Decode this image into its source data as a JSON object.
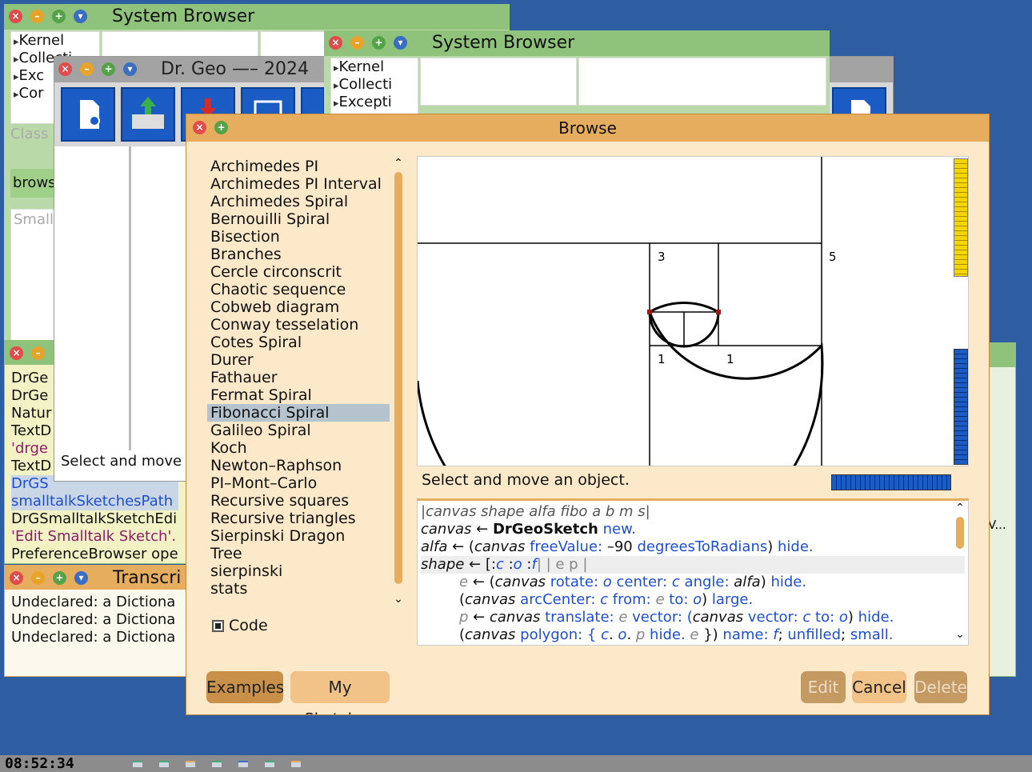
{
  "colors": {
    "desktop": "#2e5da1",
    "green_title": "#8fc27a",
    "grey_title": "#a3a3a3",
    "orange_title": "#e5ad5d",
    "orange_panel": "#fbe9ca",
    "selected": "#b5c3cf"
  },
  "sysbrowser1": {
    "title": "System Browser",
    "packages": [
      "Kernel",
      "Collecti",
      "Exc",
      "Cor"
    ],
    "class_label": "Class",
    "browse_label": "brows",
    "small_label": "Small"
  },
  "sysbrowser2": {
    "title": "System Browser",
    "packages": [
      "Kernel",
      "Collecti",
      "Excepti"
    ]
  },
  "drgeo": {
    "title": "Dr. Geo —– 2024",
    "status": "Select and move",
    "icons": [
      "new-sketch-icon",
      "open-folder-icon",
      "save-icon",
      "export-icon",
      "overflow-icon"
    ]
  },
  "workspace": {
    "lines": [
      "DrGe",
      "DrGe",
      "Natur",
      "TextD",
      "'drge",
      "TextD",
      "DrGS",
      "smalltalkSketchesPath",
      "DrGSmalltalkSketchEdi",
      "'Edit Smalltalk Sketch'.",
      "PreferenceBrowser ope"
    ]
  },
  "transcript": {
    "title": "Transcri",
    "lines": [
      "Undeclared: a Dictiona",
      "Undeclared: a Dictiona",
      "Undeclared: a Dictiona"
    ]
  },
  "right_window": {
    "scroll_label": "V..."
  },
  "browse": {
    "title": "Browse",
    "examples": [
      "Archimedes PI",
      "Archimedes PI Interval",
      "Archimedes Spiral",
      "Bernouilli Spiral",
      "Bisection",
      "Branches",
      "Cercle circonscrit",
      "Chaotic sequence",
      "Cobweb diagram",
      "Conway tesselation",
      "Cotes Spiral",
      "Durer",
      "Fathauer",
      "Fermat Spiral",
      "Fibonacci Spiral",
      "Galileo Spiral",
      "Koch",
      "Newton–Raphson",
      "PI–Mont–Carlo",
      "Recursive squares",
      "Recursive triangles",
      "Sierpinski Dragon",
      "Tree",
      "sierpinski",
      "stats"
    ],
    "selected": "Fibonacci Spiral",
    "code_checkbox": "Code",
    "preview_labels": {
      "l3": "3",
      "l5": "5",
      "l1a": "1",
      "l1b": "1"
    },
    "status": "Select and move an object.",
    "code": {
      "l1": "|canvas shape alfa fibo a b m s|",
      "l2a": "canvas",
      "l2b": " ← ",
      "l2c": "DrGeoSketch",
      "l2d": " new.",
      "l3a": "alfa",
      "l3b": " ← (",
      "l3c": "canvas",
      "l3d": " freeValue:",
      "l3e": " –90 ",
      "l3f": "degreesToRadians",
      "l3g": ") ",
      "l3h": "hide.",
      "l4a": "shape",
      "l4b": " ← [:",
      "l4c": "c",
      "l4d": " :",
      "l4e": "o",
      "l4f": " :",
      "l4g": "f",
      "l4h": "| | e p |",
      "l5a": "e",
      "l5b": " ← (",
      "l5c": "canvas",
      "l5d": " rotate: ",
      "l5e": "o",
      "l5f": " center: ",
      "l5g": "c",
      "l5h": " angle: ",
      "l5i": "alfa",
      "l5j": ") ",
      "l5k": "hide.",
      "l6a": "(",
      "l6b": "canvas",
      "l6c": " arcCenter: ",
      "l6d": "c",
      "l6e": " from: ",
      "l6f": "e",
      "l6g": " to: ",
      "l6h": "o",
      "l6i": ") ",
      "l6j": "large.",
      "l7a": "p",
      "l7b": " ← ",
      "l7c": "canvas",
      "l7d": " translate: ",
      "l7e": "e",
      "l7f": " vector: (",
      "l7g": "canvas",
      "l7h": " vector: ",
      "l7i": "c",
      "l7j": " to: ",
      "l7k": "o",
      "l7l": ") ",
      "l7m": "hide.",
      "l8a": "(",
      "l8b": "canvas",
      "l8c": " polygon: { ",
      "l8d": "c",
      "l8e": ". ",
      "l8f": "o",
      "l8g": ". ",
      "l8h": "p",
      "l8i": " hide. ",
      "l8j": "e",
      "l8k": " }) ",
      "l8l": "name: ",
      "l8m": "f",
      "l8n": "; ",
      "l8o": "unfilled",
      "l8p": "; ",
      "l8q": "small."
    },
    "buttons": {
      "examples": "Examples",
      "my_sketches": "My Sketches",
      "edit": "Edit",
      "cancel": "Cancel",
      "delete": "Delete"
    }
  },
  "taskbar": {
    "clock": "08:52:34"
  }
}
